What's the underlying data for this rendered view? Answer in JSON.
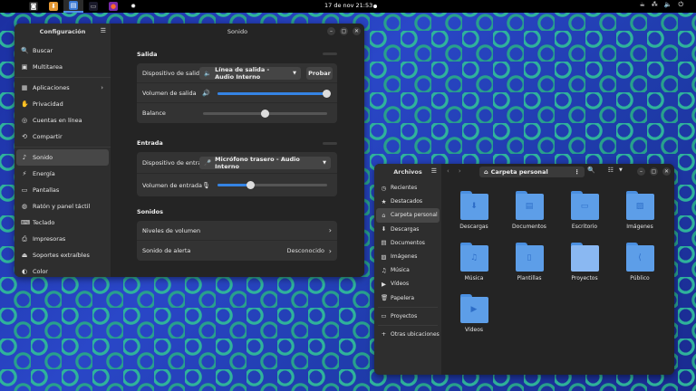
{
  "topbar": {
    "apps": [
      {
        "icon": "camera-icon",
        "glyph": "◙",
        "color": "#ffffff",
        "bg": "#2a2a2a"
      },
      {
        "icon": "archive-manager-icon",
        "glyph": "⬇",
        "color": "#ffffff",
        "bg": "#e59934"
      },
      {
        "icon": "text-editor-icon",
        "glyph": "▤",
        "color": "#ffffff",
        "bg": "#3b7ad6"
      },
      {
        "icon": "terminal-icon",
        "glyph": "▭",
        "color": "#bbbbbb",
        "bg": "#1a1a2a"
      },
      {
        "icon": "firefox-icon",
        "glyph": "●",
        "color": "#ff6a2a",
        "bg": "#7b2aa8"
      },
      {
        "icon": "settings-gear-icon",
        "glyph": "✹",
        "color": "#ffffff",
        "bg": "transparent"
      }
    ],
    "clock": "17 de nov  21:53",
    "tray": [
      "☕",
      "⁂",
      "🔈",
      "⏻"
    ]
  },
  "settings": {
    "sidebar_title": "Configuración",
    "window_title": "Sonido",
    "sidebar": [
      {
        "icon": "🔍",
        "label": "Buscar"
      },
      {
        "icon": "▣",
        "label": "Multitarea"
      },
      {
        "sep": true
      },
      {
        "icon": "▦",
        "label": "Aplicaciones",
        "chevron": true
      },
      {
        "icon": "✋",
        "label": "Privacidad"
      },
      {
        "icon": "◎",
        "label": "Cuentas en línea"
      },
      {
        "icon": "⟲",
        "label": "Compartir"
      },
      {
        "sep": true
      },
      {
        "icon": "♪",
        "label": "Sonido",
        "active": true
      },
      {
        "icon": "⚡",
        "label": "Energía"
      },
      {
        "icon": "▭",
        "label": "Pantallas"
      },
      {
        "icon": "◍",
        "label": "Ratón y panel táctil"
      },
      {
        "icon": "⌨",
        "label": "Teclado"
      },
      {
        "icon": "⎙",
        "label": "Impresoras"
      },
      {
        "icon": "⏏",
        "label": "Soportes extraíbles"
      },
      {
        "icon": "◐",
        "label": "Color"
      }
    ],
    "salida": {
      "title": "Salida",
      "device_label": "Dispositivo de salida",
      "device_value": "Línea de salida - Audio Interno",
      "test_button": "Probar",
      "volume_label": "Volumen de salida",
      "volume_level": 1.0,
      "balance_label": "Balance",
      "balance_level": 0.5
    },
    "entrada": {
      "title": "Entrada",
      "device_label": "Dispositivo de entrada",
      "device_value": "Micrófono trasero - Audio Interno",
      "volume_label": "Volumen de entrada",
      "volume_level": 0.3
    },
    "sonidos": {
      "title": "Sonidos",
      "levels_label": "Niveles de volumen",
      "alert_label": "Sonido de alerta",
      "alert_value": "Desconocido"
    }
  },
  "files": {
    "sidebar_title": "Archivos",
    "path": "Carpeta personal",
    "sidebar": [
      {
        "icon": "◷",
        "label": "Recientes"
      },
      {
        "icon": "★",
        "label": "Destacados"
      },
      {
        "icon": "⌂",
        "label": "Carpeta personal",
        "active": true
      },
      {
        "icon": "⬇",
        "label": "Descargas"
      },
      {
        "icon": "▤",
        "label": "Documentos"
      },
      {
        "icon": "▨",
        "label": "Imágenes"
      },
      {
        "icon": "♫",
        "label": "Música"
      },
      {
        "icon": "▶",
        "label": "Vídeos"
      },
      {
        "icon": "🗑",
        "label": "Papelera"
      },
      {
        "sep": true
      },
      {
        "icon": "▭",
        "label": "Proyectos"
      },
      {
        "sep": true
      },
      {
        "icon": "+",
        "label": "Otras ubicaciones"
      }
    ],
    "folders": [
      {
        "name": "Descargas",
        "emblem": "⬇",
        "plain": false
      },
      {
        "name": "Documentos",
        "emblem": "▤",
        "plain": false
      },
      {
        "name": "Escritorio",
        "emblem": "▭",
        "plain": false
      },
      {
        "name": "Imágenes",
        "emblem": "▨",
        "plain": false
      },
      {
        "name": "Música",
        "emblem": "♫",
        "plain": false
      },
      {
        "name": "Plantillas",
        "emblem": "▯",
        "plain": false
      },
      {
        "name": "Proyectos",
        "emblem": "",
        "plain": true
      },
      {
        "name": "Público",
        "emblem": "⟨",
        "plain": false
      },
      {
        "name": "Vídeos",
        "emblem": "▶",
        "plain": false
      }
    ]
  }
}
